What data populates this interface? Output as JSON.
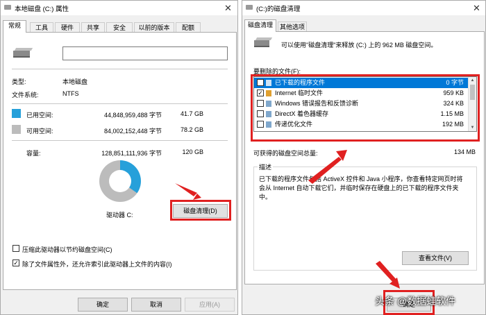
{
  "left": {
    "title": "本地磁盘 (C:) 属性",
    "tabs": [
      "常规",
      "工具",
      "硬件",
      "共享",
      "安全",
      "以前的版本",
      "配额"
    ],
    "name_value": "",
    "type_label": "类型:",
    "type_value": "本地磁盘",
    "fs_label": "文件系统:",
    "fs_value": "NTFS",
    "used_label": "已用空间:",
    "used_bytes": "44,848,959,488 字节",
    "used_gb": "41.7 GB",
    "free_label": "可用空间:",
    "free_bytes": "84,002,152,448 字节",
    "free_gb": "78.2 GB",
    "cap_label": "容量:",
    "cap_bytes": "128,851,111,936 字节",
    "cap_gb": "120 GB",
    "used_fraction": 0.348,
    "used_color": "#26a0da",
    "free_color": "#bcbcbc",
    "drive_label": "驱动器 C:",
    "cleanup_button": "磁盘清理(D)",
    "compress_label": "压缩此驱动器以节约磁盘空间(C)",
    "compress_checked": false,
    "index_label": "除了文件属性外，还允许索引此驱动器上文件的内容(I)",
    "index_checked": true,
    "ok": "确定",
    "cancel": "取消",
    "apply": "应用(A)"
  },
  "right": {
    "title": "(C:)的磁盘清理",
    "tabs": [
      "磁盘清理",
      "其他选项"
    ],
    "intro": "可以使用\"磁盘清理\"来释放 (C:) 上的 962 MB 磁盘空间。",
    "files_label": "要删除的文件(F):",
    "files": [
      {
        "name": "已下载的程序文件",
        "size": "0 字节",
        "checked": true,
        "selected": true
      },
      {
        "name": "Internet 临时文件",
        "size": "959 KB",
        "checked": true,
        "selected": false
      },
      {
        "name": "Windows 错误报告和反馈诊断",
        "size": "324 KB",
        "checked": false,
        "selected": false
      },
      {
        "name": "DirectX 着色器缓存",
        "size": "1.15 MB",
        "checked": false,
        "selected": false
      },
      {
        "name": "传递优化文件",
        "size": "192 MB",
        "checked": false,
        "selected": false
      }
    ],
    "total_label": "可获得的磁盘空间总量:",
    "total_value": "134 MB",
    "desc_label": "描述",
    "desc_text": "已下载的程序文件包括 ActiveX 控件和 Java 小程序，你查看特定网页时将会从 Internet 自动下载它们，并临时保存在硬盘上的已下载的程序文件夹中。",
    "view_files": "查看文件(V)",
    "ok": "确定"
  },
  "watermark": "头条 @数据蛙软件",
  "highlight_color": "#e02020"
}
